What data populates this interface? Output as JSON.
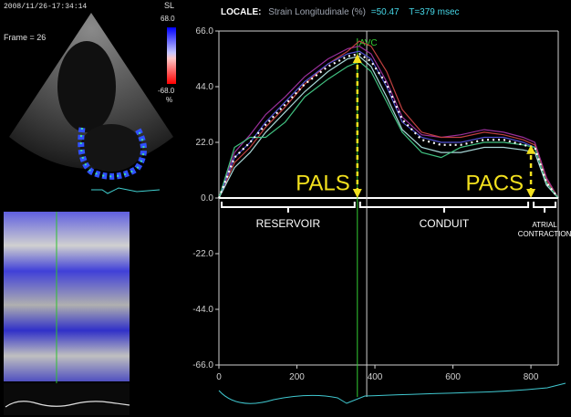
{
  "echo": {
    "timestamp": "2008/11/26-17:34:14",
    "frame_label": "Frame = 26",
    "scale_label": "SL",
    "scale_max": "68.0",
    "scale_min": "-68.0",
    "scale_unit": "%"
  },
  "header": {
    "mode": "LOCALE:",
    "measure": "Strain Longitudinale (%)",
    "value": "=50.47",
    "time": "T=379 msec"
  },
  "colors": {
    "mode": "#ffffff",
    "measure": "#9ea4b0",
    "value": "#46d8e8",
    "time": "#46d8e8",
    "annotation": "#f2e01e",
    "axis": "#d0d0d0",
    "avc": "#33cc33"
  },
  "chart_data": {
    "type": "line",
    "xlim": [
      0,
      870
    ],
    "ylim": [
      -66,
      66
    ],
    "xticks": [
      0,
      200,
      400,
      600,
      800
    ],
    "yticks": [
      66,
      44,
      22,
      0,
      -22,
      -44,
      -66
    ],
    "ytick_labels": [
      "66.0",
      "44.0",
      "22.0",
      "0.0",
      "-22.0",
      "-44.0",
      "-66.0"
    ],
    "series": [
      {
        "color": "#9a2f9a",
        "x": [
          0,
          40,
          80,
          120,
          170,
          220,
          280,
          330,
          360,
          390,
          430,
          470,
          520,
          570,
          620,
          680,
          730,
          780,
          810,
          840,
          870
        ],
        "y": [
          0,
          18,
          25,
          33,
          40,
          48,
          55,
          59,
          60,
          57,
          46,
          32,
          25,
          24,
          25,
          27,
          26,
          24,
          22,
          8,
          0
        ]
      },
      {
        "color": "#c04040",
        "x": [
          0,
          40,
          80,
          120,
          170,
          220,
          280,
          330,
          360,
          390,
          430,
          470,
          520,
          570,
          620,
          680,
          730,
          780,
          810,
          840,
          870
        ],
        "y": [
          0,
          14,
          20,
          28,
          36,
          45,
          53,
          58,
          62,
          60,
          50,
          35,
          26,
          24,
          24,
          26,
          25,
          23,
          21,
          7,
          0
        ]
      },
      {
        "color": "#5050d0",
        "x": [
          0,
          40,
          80,
          120,
          170,
          220,
          280,
          330,
          360,
          390,
          430,
          470,
          520,
          570,
          620,
          680,
          730,
          780,
          810,
          840,
          870
        ],
        "y": [
          0,
          16,
          22,
          30,
          38,
          46,
          53,
          57,
          58,
          55,
          44,
          30,
          24,
          22,
          22,
          24,
          24,
          22,
          20,
          6,
          0
        ]
      },
      {
        "color": "#a8d8d8",
        "x": [
          0,
          40,
          80,
          120,
          170,
          220,
          280,
          330,
          360,
          390,
          430,
          470,
          520,
          570,
          620,
          680,
          730,
          780,
          810,
          840,
          870
        ],
        "y": [
          0,
          12,
          18,
          26,
          34,
          42,
          50,
          55,
          56,
          52,
          40,
          27,
          20,
          18,
          18,
          20,
          20,
          19,
          18,
          5,
          0
        ]
      },
      {
        "color": "#40c080",
        "x": [
          0,
          40,
          80,
          120,
          170,
          220,
          280,
          330,
          360,
          390,
          430,
          470,
          520,
          570,
          620,
          680,
          730,
          780,
          810,
          840,
          870
        ],
        "y": [
          0,
          20,
          24,
          24,
          30,
          40,
          47,
          52,
          54,
          50,
          38,
          26,
          18,
          16,
          20,
          22,
          22,
          21,
          20,
          6,
          0
        ]
      },
      {
        "color": "#ffffff",
        "dashed": true,
        "x": [
          0,
          40,
          80,
          120,
          170,
          220,
          280,
          330,
          360,
          390,
          430,
          470,
          520,
          570,
          620,
          680,
          730,
          780,
          810,
          840,
          870
        ],
        "y": [
          0,
          16,
          22,
          29,
          37,
          45,
          52,
          56,
          57,
          54,
          45,
          31,
          23,
          21,
          21,
          23,
          23,
          21,
          20,
          6,
          0
        ]
      }
    ],
    "cursor_x": 379,
    "avc_x": 355,
    "avc_label": "AVC",
    "annotations": [
      {
        "text": "PALS",
        "x": 355,
        "y_from": 0,
        "y_to": 57
      },
      {
        "text": "PACS",
        "x": 800,
        "y_from": 0,
        "y_to": 21
      }
    ],
    "phases": [
      {
        "label": "RESERVOIR",
        "from": 0,
        "to": 355
      },
      {
        "label": "CONDUIT",
        "from": 355,
        "to": 800
      },
      {
        "label": "ATRIAL\nCONTRACTION",
        "from": 800,
        "to": 870
      }
    ]
  }
}
